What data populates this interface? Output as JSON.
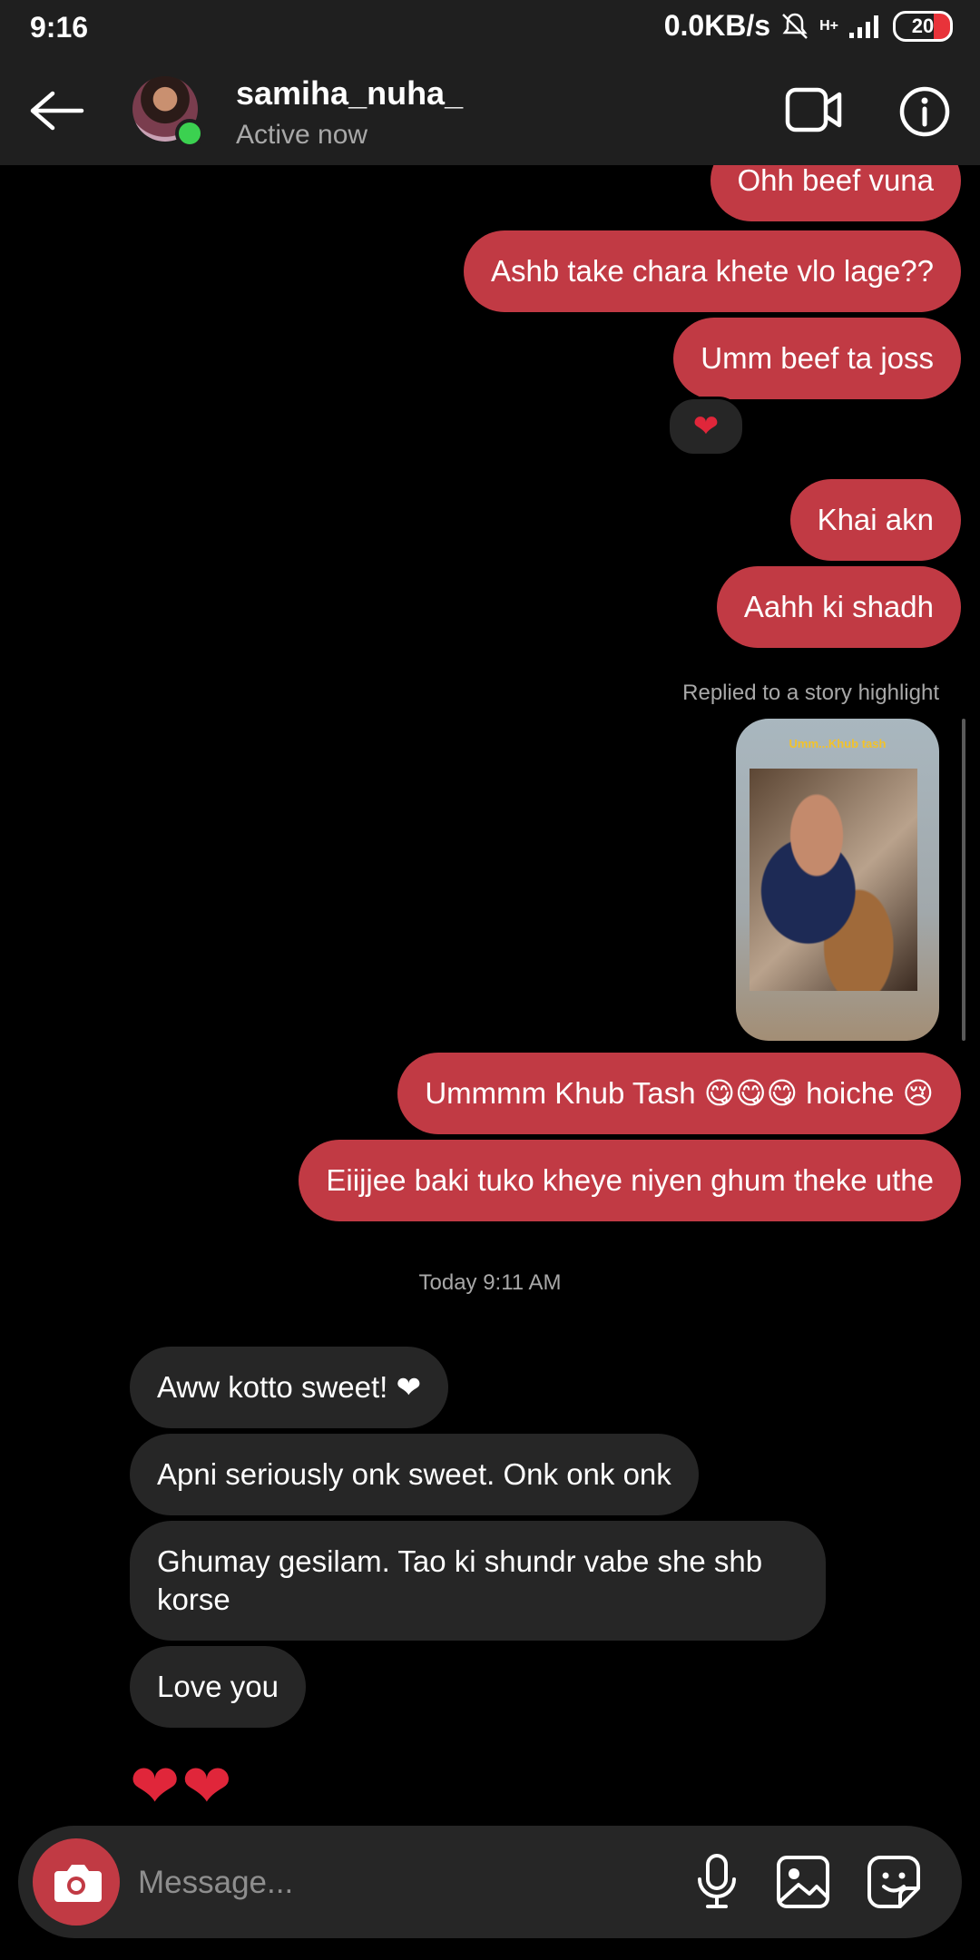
{
  "status_bar": {
    "time": "9:16",
    "net_speed": "0.0KB/s",
    "network_type": "H+",
    "battery": "20"
  },
  "header": {
    "username": "samiha_nuha_",
    "status": "Active now",
    "icons": [
      "back-arrow-icon",
      "video-call-icon",
      "info-icon"
    ]
  },
  "messages": {
    "sent": [
      "Ohh beef vuna",
      "Ashb take chara khete vlo lage??",
      "Umm beef ta joss",
      "Khai akn",
      "Aahh ki shadh",
      "Ummmm Khub Tash 😋😋😋 hoiche 😢",
      "Eiijjee baki tuko kheye niyen ghum theke uthe"
    ],
    "reaction": "❤",
    "reply_label": "Replied to a story highlight",
    "story_caption": "Umm...Khub tash",
    "timestamp": "Today 9:11 AM",
    "received": [
      "Aww kotto sweet! ❤",
      "Apni seriously onk sweet. Onk onk onk",
      "Ghumay gesilam. Tao ki shundr vabe she shb korse",
      "Love you"
    ],
    "big_hearts": "❤❤"
  },
  "composer": {
    "placeholder": "Message..."
  },
  "colors": {
    "sent_bubble": "#c13a44",
    "received_bubble": "#262626",
    "header_bg": "#1f1f1f",
    "online": "#3bd150"
  }
}
